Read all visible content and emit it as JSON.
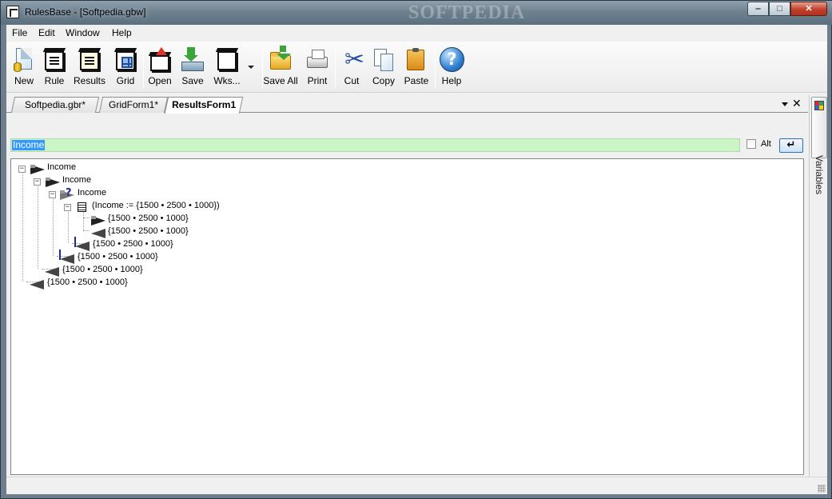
{
  "window": {
    "title": "RulesBase - [Softpedia.gbw]",
    "watermark": "SOFTPEDIA",
    "minimize": "‒",
    "maximize": "□",
    "close": "✕"
  },
  "menu": [
    "File",
    "Edit",
    "Window",
    "Help"
  ],
  "toolbar": {
    "new": "New",
    "rule": "Rule",
    "results": "Results",
    "grid": "Grid",
    "open": "Open",
    "save": "Save",
    "wks": "Wks...",
    "save_all": "Save All",
    "print": "Print",
    "cut": "Cut",
    "copy": "Copy",
    "paste": "Paste",
    "help": "Help",
    "help_glyph": "?",
    "cut_glyph": "✂"
  },
  "tabs": [
    {
      "label": "Softpedia.gbr*"
    },
    {
      "label": "GridForm1*"
    },
    {
      "label": "ResultsForm1",
      "active": true
    }
  ],
  "tabs_close": "✕",
  "dock": {
    "label": "Variables"
  },
  "formula": {
    "value": "Income",
    "alt_label": "Alt",
    "enter_glyph": "↵",
    "alt_checked": false
  },
  "tree": {
    "expanded": "−",
    "nodes": [
      {
        "text": "Income"
      },
      {
        "text": "Income"
      },
      {
        "text": "Income"
      },
      {
        "text": "(Income := {1500 • 2500 • 1000})"
      },
      {
        "text": "{1500 • 2500 • 1000}"
      },
      {
        "text": "{1500 • 2500 • 1000}"
      },
      {
        "text": "{1500 • 2500 • 1000}"
      },
      {
        "text": "{1500 • 2500 • 1000}"
      },
      {
        "text": "{1500 • 2500 • 1000}"
      },
      {
        "text": "{1500 • 2500 • 1000}"
      }
    ]
  }
}
